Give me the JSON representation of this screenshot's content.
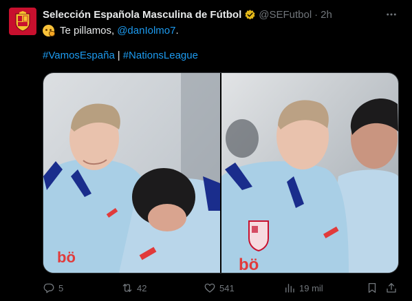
{
  "tweet": {
    "author_name": "Selección Española Masculina de Fútbol",
    "handle": "@SEFutbol",
    "separator": "·",
    "time": "2h",
    "text": "Te pillamos,",
    "mention": "@danIolmo7",
    "text_end": ".",
    "hashtag1": "#VamosEspaña",
    "hashtag_sep": "|",
    "hashtag2": "#NationsLeague"
  },
  "actions": {
    "replies": "5",
    "retweets": "42",
    "likes": "541",
    "views": "19 mil"
  },
  "icons": {
    "verified": "gold-check-icon",
    "avatar": "spain-crest-icon",
    "more": "more-dots-icon",
    "reply": "reply-icon",
    "retweet": "retweet-icon",
    "like": "heart-icon",
    "views": "views-chart-icon",
    "bookmark": "bookmark-icon",
    "share": "share-icon"
  },
  "colors": {
    "background": "#000000",
    "text": "#e7e9ea",
    "muted": "#71767b",
    "link": "#1d9bf0",
    "verified": "#e2b719",
    "avatar_bg": "#c8102e"
  }
}
